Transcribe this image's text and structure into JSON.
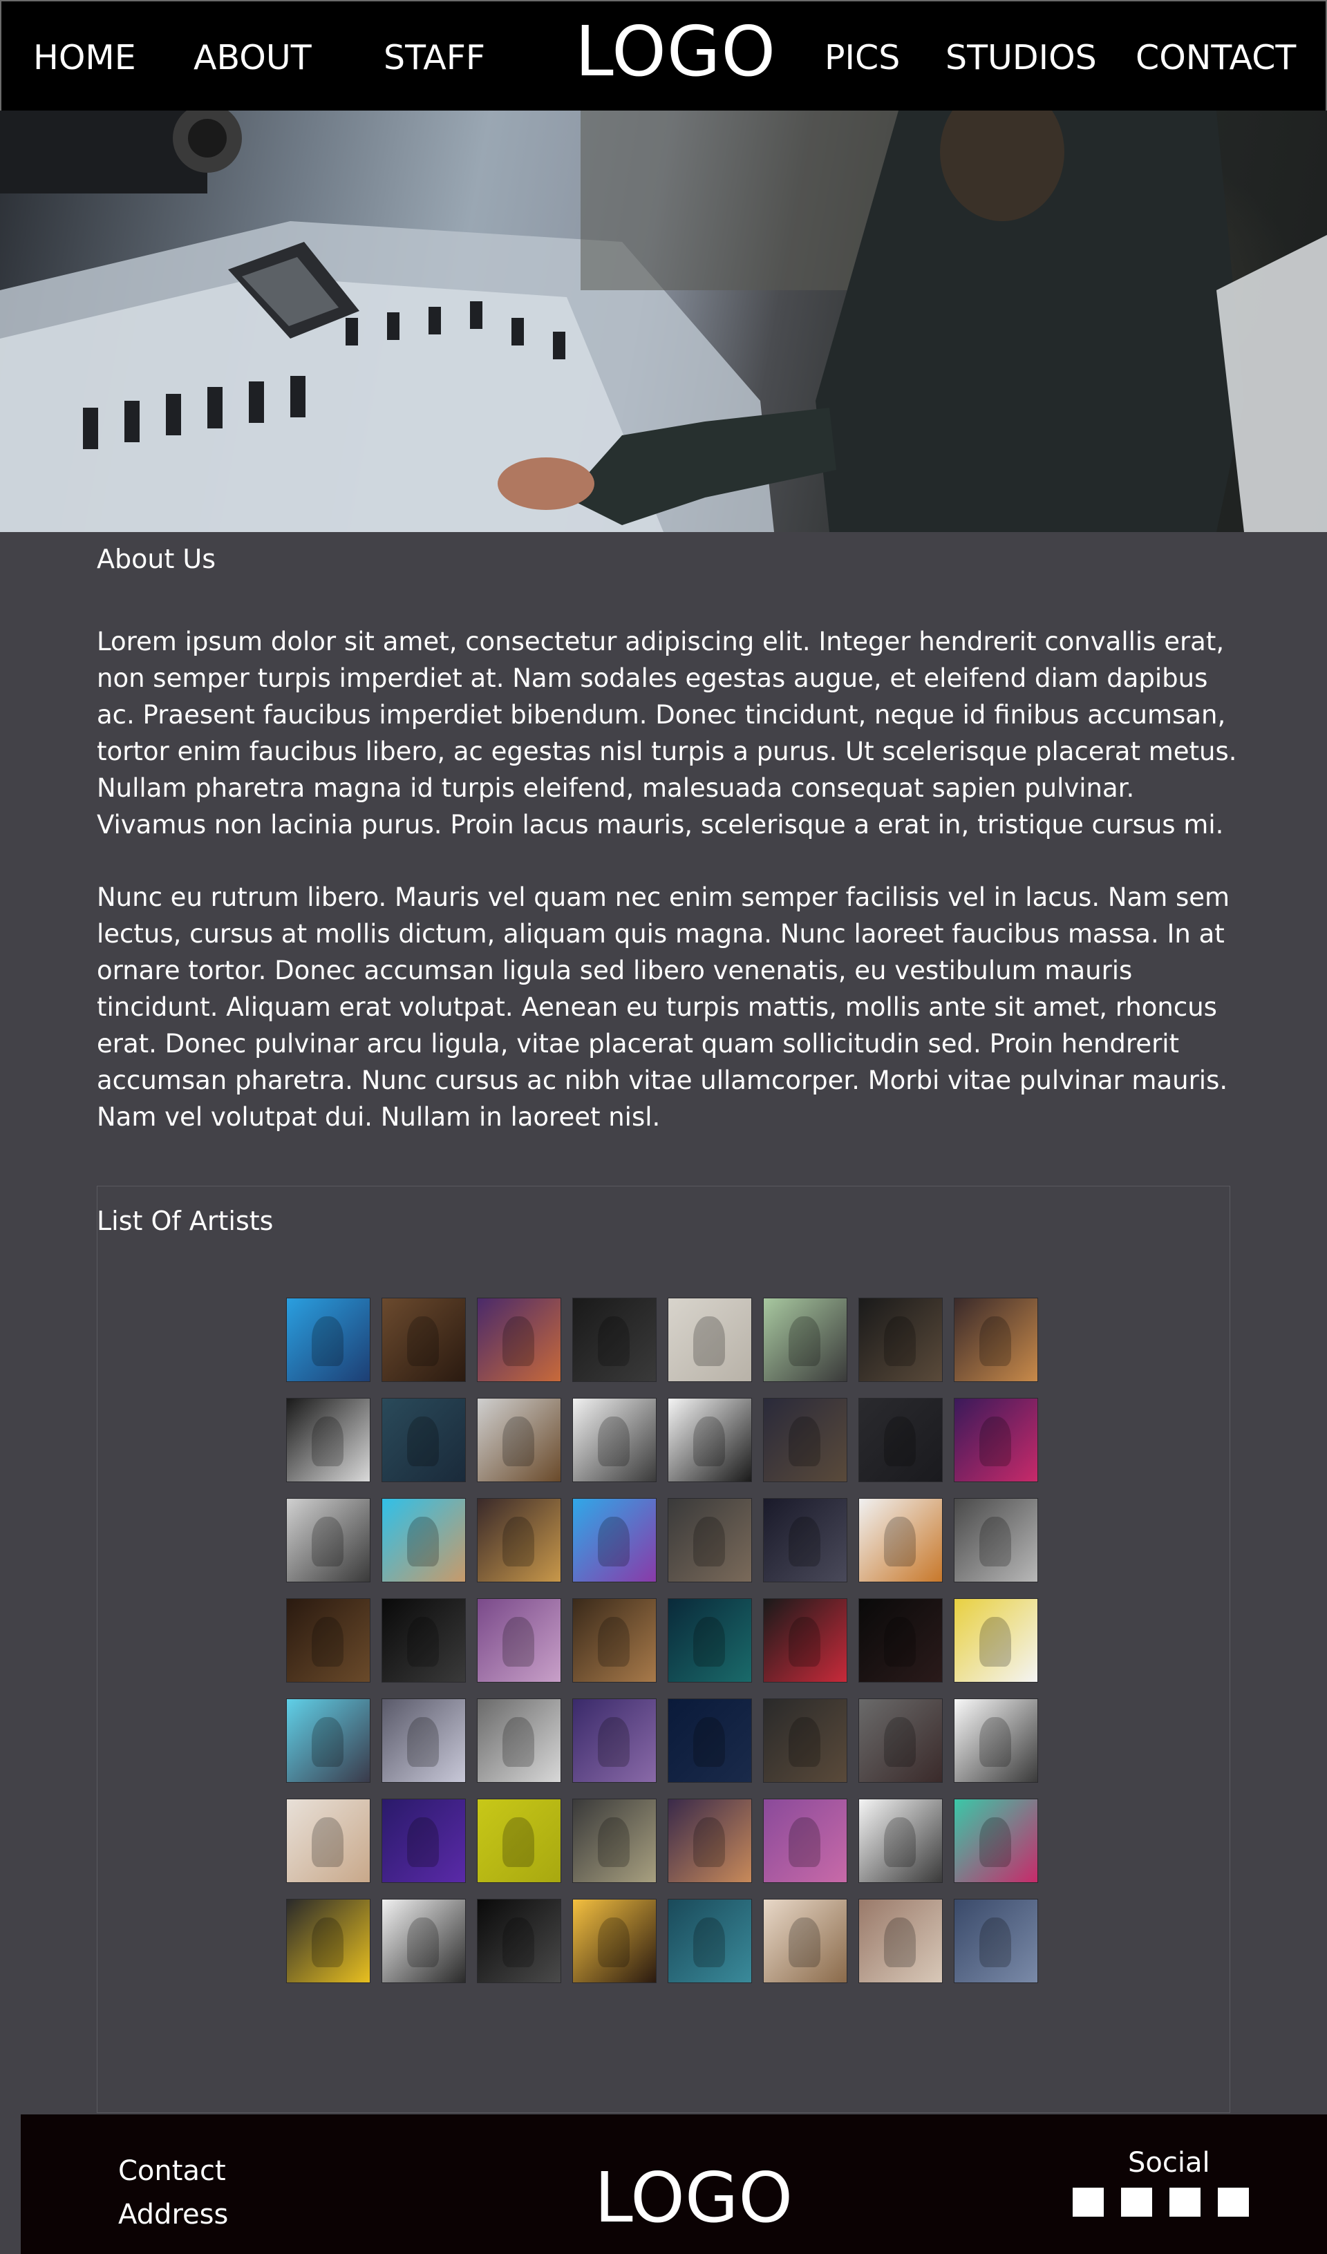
{
  "nav": {
    "items": [
      {
        "label": "HOME"
      },
      {
        "label": "ABOUT"
      },
      {
        "label": "STAFF"
      },
      {
        "label": "PICS"
      },
      {
        "label": "STUDIOS"
      },
      {
        "label": "CONTACT"
      }
    ],
    "logo": "LOGO"
  },
  "hero": {
    "image": "recording-studio-mixing-console-photo"
  },
  "about": {
    "title": "About Us",
    "paragraphs": [
      "Lorem ipsum dolor sit amet, consectetur adipiscing elit. Integer hendrerit convallis erat, non semper turpis imperdiet at. Nam sodales egestas augue, et eleifend diam dapibus ac. Praesent faucibus imperdiet bibendum. Donec tincidunt, neque id finibus accumsan, tortor enim faucibus libero, ac egestas nisl turpis a purus. Ut scelerisque placerat metus. Nullam pharetra magna id turpis eleifend, malesuada consequat sapien pulvinar. Vivamus non lacinia purus. Proin lacus mauris, scelerisque a erat in, tristique cursus mi.",
      "Nunc eu rutrum libero. Mauris vel quam nec enim semper facilisis vel in lacus. Nam sem lectus, cursus at mollis dictum, aliquam quis magna. Nunc laoreet faucibus massa. In at ornare tortor. Donec accumsan ligula sed libero venenatis, eu vestibulum mauris tincidunt. Aliquam erat volutpat. Aenean eu turpis mattis, mollis ante sit amet, rhoncus erat. Donec pulvinar arcu ligula, vitae placerat quam sollicitudin sed. Proin hendrerit accumsan pharetra. Nunc cursus ac nibh vitae ullamcorper. Morbi vitae pulvinar mauris. Nam vel volutpat dui. Nullam in laoreet nisl."
    ]
  },
  "artists": {
    "title": "List Of Artists",
    "thumbnails": [
      [
        "#2a9fe0",
        "#1d3e73"
      ],
      [
        "#6b4a2e",
        "#2a1a10"
      ],
      [
        "#4a2a6a",
        "#c86a3a"
      ],
      [
        "#1a1a1a",
        "#3a3a3a"
      ],
      [
        "#d8d4cc",
        "#b8b2a8"
      ],
      [
        "#a8c8a0",
        "#3a3a3a"
      ],
      [
        "#1a1a1a",
        "#5a4a3a"
      ],
      [
        "#3a2a2a",
        "#c88a4a"
      ],
      [
        "#1a1a1a",
        "#dadada"
      ],
      [
        "#2a4a5a",
        "#1a2a3a"
      ],
      [
        "#cfcfcf",
        "#6a4a2a"
      ],
      [
        "#f0f0f0",
        "#3a3a3a"
      ],
      [
        "#f4f4f4",
        "#1a1a1a"
      ],
      [
        "#2a2a3a",
        "#5a4a3a"
      ],
      [
        "#2a2a2e",
        "#1a1a1e"
      ],
      [
        "#3a1a5a",
        "#c82a6a"
      ],
      [
        "#d0d0d0",
        "#3a3a3a"
      ],
      [
        "#30c0e8",
        "#c89a6a"
      ],
      [
        "#3a2a2a",
        "#c8984a"
      ],
      [
        "#30a8e8",
        "#8a3aa8"
      ],
      [
        "#3a3a3a",
        "#7a6a5a"
      ],
      [
        "#1a1a2a",
        "#4a4a5a"
      ],
      [
        "#f0f0f0",
        "#c8782a"
      ],
      [
        "#4a4a4a",
        "#b8b8b8"
      ],
      [
        "#2a1a10",
        "#6a4a2a"
      ],
      [
        "#0a0a0a",
        "#3a3a3a"
      ],
      [
        "#7a4a8a",
        "#c8a0c8"
      ],
      [
        "#3a2a1a",
        "#a87a4a"
      ],
      [
        "#0a2a3a",
        "#1a6a6a"
      ],
      [
        "#1a1a1a",
        "#c82a3a"
      ],
      [
        "#0a0a0a",
        "#2a1a1a"
      ],
      [
        "#e8d040",
        "#f4f4f4"
      ],
      [
        "#60d0e8",
        "#3a3a4a"
      ],
      [
        "#5a5a6a",
        "#c8c8d8"
      ],
      [
        "#6a6a6a",
        "#d8d8d8"
      ],
      [
        "#3a2a6a",
        "#8a6aa8"
      ],
      [
        "#0a1a3a",
        "#1a2a4a"
      ],
      [
        "#2a2a2a",
        "#5a4a3a"
      ],
      [
        "#6a6a6a",
        "#3a2a2a"
      ],
      [
        "#f8f8f8",
        "#3a3a3a"
      ],
      [
        "#e8e0d8",
        "#c8a88a"
      ],
      [
        "#2a1a6a",
        "#5a2aa8"
      ],
      [
        "#c8c818",
        "#a8a810"
      ],
      [
        "#3a3a3a",
        "#a8a080"
      ],
      [
        "#3a2a4a",
        "#c88a5a"
      ],
      [
        "#8a4a9a",
        "#c86aa8"
      ],
      [
        "#f4f4f4",
        "#3a3a3a"
      ],
      [
        "#3ac8a8",
        "#c82a6a"
      ],
      [
        "#2a2a2a",
        "#e8c020"
      ],
      [
        "#f0f0f0",
        "#2a2a2a"
      ],
      [
        "#0a0a0a",
        "#4a4a4a"
      ],
      [
        "#f4c040",
        "#2a1a10"
      ],
      [
        "#1a4a5a",
        "#3a8a9a"
      ],
      [
        "#e8d8c8",
        "#8a6a4a"
      ],
      [
        "#9a7a6a",
        "#d8c8b8"
      ],
      [
        "#3a4a6a",
        "#7a8aa8"
      ]
    ]
  },
  "footer": {
    "contact": "Contact",
    "address": "Address",
    "logo": "LOGO",
    "social_title": "Social",
    "social_icons": [
      "social-icon-1",
      "social-icon-2",
      "social-icon-3",
      "social-icon-4"
    ]
  },
  "colors": {
    "nav_background": "#000000",
    "page_background": "#434248",
    "footer_background": "#0b0203",
    "text": "#ffffff"
  }
}
